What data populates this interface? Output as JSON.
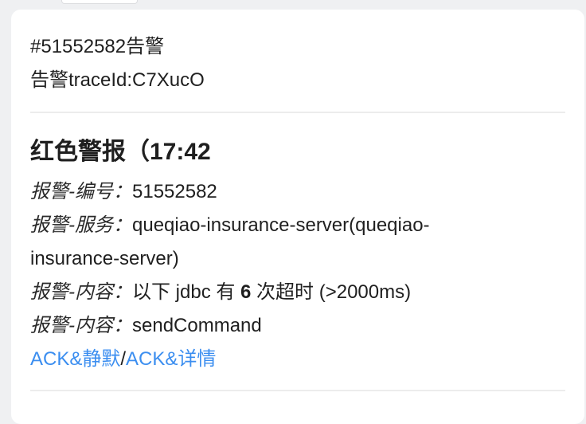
{
  "header": {
    "alert_id_line": "#51552582告警",
    "trace_line": "告警traceId:C7XucO"
  },
  "alert": {
    "title": "红色警报（17:42",
    "rows": [
      {
        "label": "报警-编号：",
        "value": "51552582"
      },
      {
        "label": "报警-服务：",
        "value": "queqiao-insurance-server(queqiao-",
        "value_cont": "insurance-server)"
      },
      {
        "label": "报警-内容：",
        "value_pre": "以下 jdbc 有 ",
        "value_bold": "6",
        "value_post": " 次超时 (>2000ms)"
      },
      {
        "label": "报警-内容：",
        "value": "sendCommand"
      }
    ],
    "links": {
      "silence": "ACK&静默",
      "separator": "/",
      "detail": "ACK&详情"
    }
  },
  "colors": {
    "link": "#3b8ef0",
    "background": "#eff0f2",
    "card": "#ffffff"
  }
}
